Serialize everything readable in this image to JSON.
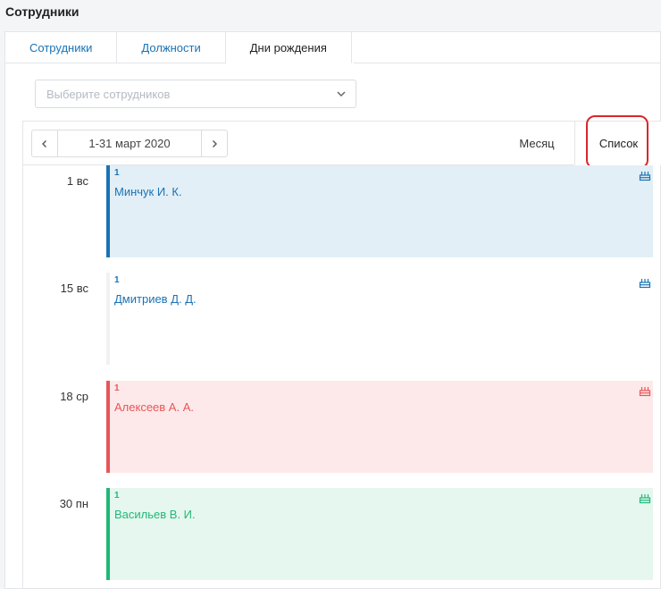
{
  "page": {
    "title": "Сотрудники"
  },
  "tabs": [
    {
      "label": "Сотрудники",
      "active": false
    },
    {
      "label": "Должности",
      "active": false
    },
    {
      "label": "Дни рождения",
      "active": true
    }
  ],
  "filter": {
    "placeholder": "Выберите сотрудников"
  },
  "calendar": {
    "range": "1-31 март 2020",
    "views": {
      "month": "Месяц",
      "list": "Список"
    },
    "active_view": "list",
    "events": [
      {
        "day": "1 вс",
        "count": "1",
        "name": "Минчук И. К.",
        "color": "#1a73b5",
        "bg": "#e2eff7",
        "bar": "#1a73b5"
      },
      {
        "day": "15 вс",
        "count": "1",
        "name": "Дмитриев Д. Д.",
        "color": "#1a73b5",
        "bg": "#ffffff",
        "bar": "#f0f1f3"
      },
      {
        "day": "18 ср",
        "count": "1",
        "name": "Алексеев А. А.",
        "color": "#e8555a",
        "bg": "#fde9e9",
        "bar": "#e8555a"
      },
      {
        "day": "30 пн",
        "count": "1",
        "name": "Васильев В. И.",
        "color": "#21b877",
        "bg": "#e6f7ef",
        "bar": "#21b877"
      }
    ]
  },
  "colors": {
    "accent": "#1a73b5",
    "highlight": "#d9262c",
    "border": "#e3e5e8"
  }
}
